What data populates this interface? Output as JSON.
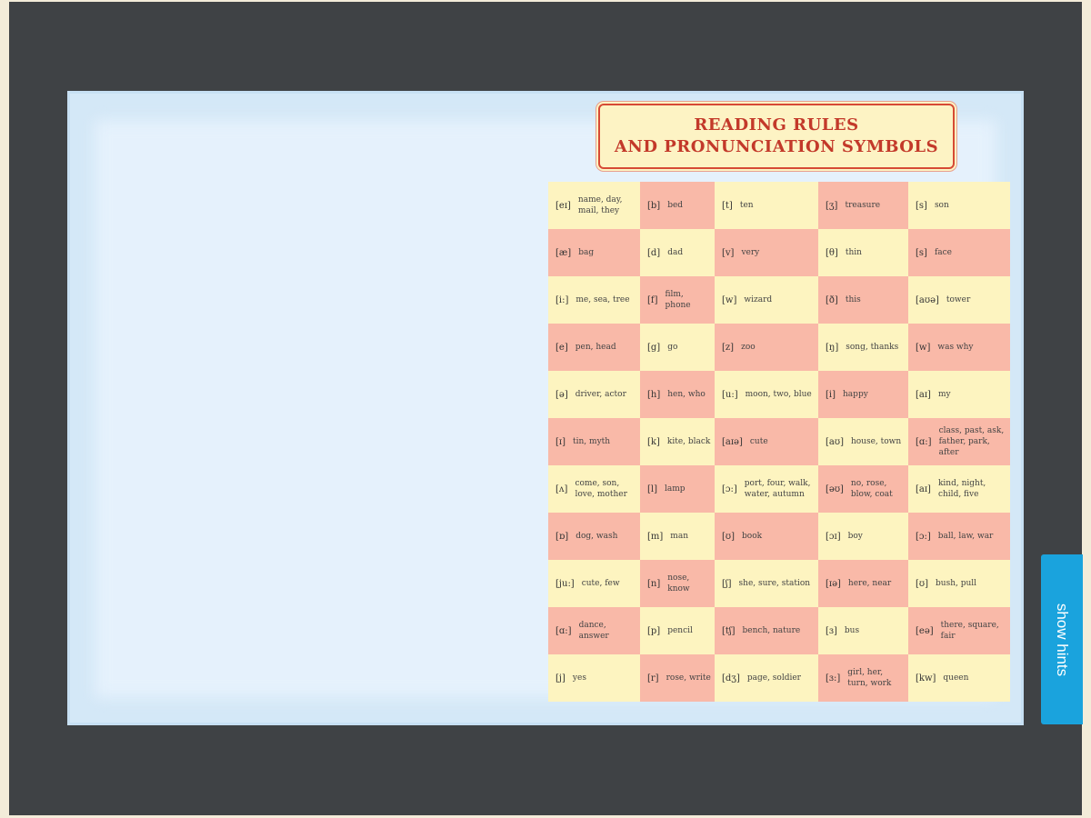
{
  "title": {
    "line1": "READING RULES",
    "line2": "AND PRONUNCIATION SYMBOLS"
  },
  "cell_colors": {
    "yellow": "#fdf4c0",
    "pink": "#f9b9a8"
  },
  "table": [
    [
      {
        "sym": "[eɪ]",
        "ex": "name, day, mail, they",
        "bg": "y"
      },
      {
        "sym": "[b]",
        "ex": "bed",
        "bg": "p"
      },
      {
        "sym": "[t]",
        "ex": "ten",
        "bg": "y"
      },
      {
        "sym": "[ʒ]",
        "ex": "treasure",
        "bg": "p"
      },
      {
        "sym": "[s]",
        "ex": "son",
        "bg": "y"
      }
    ],
    [
      {
        "sym": "[æ]",
        "ex": "bag",
        "bg": "p"
      },
      {
        "sym": "[d]",
        "ex": "dad",
        "bg": "y"
      },
      {
        "sym": "[v]",
        "ex": "very",
        "bg": "p"
      },
      {
        "sym": "[θ]",
        "ex": "thin",
        "bg": "y"
      },
      {
        "sym": "[s]",
        "ex": "face",
        "bg": "p"
      }
    ],
    [
      {
        "sym": "[i:]",
        "ex": "me, sea, tree",
        "bg": "y"
      },
      {
        "sym": "[f]",
        "ex": "film, phone",
        "bg": "p"
      },
      {
        "sym": "[w]",
        "ex": "wizard",
        "bg": "y"
      },
      {
        "sym": "[ð]",
        "ex": "this",
        "bg": "p"
      },
      {
        "sym": "[aʊə]",
        "ex": "tower",
        "bg": "y"
      }
    ],
    [
      {
        "sym": "[e]",
        "ex": "pen, head",
        "bg": "p"
      },
      {
        "sym": "[g]",
        "ex": "go",
        "bg": "y"
      },
      {
        "sym": "[z]",
        "ex": "zoo",
        "bg": "p"
      },
      {
        "sym": "[ŋ]",
        "ex": "song, thanks",
        "bg": "y"
      },
      {
        "sym": "[w]",
        "ex": "was why",
        "bg": "p"
      }
    ],
    [
      {
        "sym": "[ə]",
        "ex": "driver, actor",
        "bg": "y"
      },
      {
        "sym": "[h]",
        "ex": "hen, who",
        "bg": "p"
      },
      {
        "sym": "[u:]",
        "ex": "moon, two, blue",
        "bg": "y"
      },
      {
        "sym": "[i]",
        "ex": "happy",
        "bg": "p"
      },
      {
        "sym": "[aɪ]",
        "ex": "my",
        "bg": "y"
      }
    ],
    [
      {
        "sym": "[ɪ]",
        "ex": "tin, myth",
        "bg": "p"
      },
      {
        "sym": "[k]",
        "ex": "kite, black",
        "bg": "y"
      },
      {
        "sym": "[aɪə]",
        "ex": "cute",
        "bg": "p"
      },
      {
        "sym": "[aʊ]",
        "ex": "house, town",
        "bg": "y"
      },
      {
        "sym": "[ɑ:]",
        "ex": "class, past, ask, father, park, after",
        "bg": "p"
      }
    ],
    [
      {
        "sym": "[ʌ]",
        "ex": "come, son, love, mother",
        "bg": "y"
      },
      {
        "sym": "[l]",
        "ex": "lamp",
        "bg": "p"
      },
      {
        "sym": "[ɔ:]",
        "ex": "port, four, walk, water, autumn",
        "bg": "y"
      },
      {
        "sym": "[əʊ]",
        "ex": "no, rose, blow, coat",
        "bg": "p"
      },
      {
        "sym": "[aɪ]",
        "ex": "kind, night, child, five",
        "bg": "y"
      }
    ],
    [
      {
        "sym": "[ɒ]",
        "ex": "dog, wash",
        "bg": "p"
      },
      {
        "sym": "[m]",
        "ex": "man",
        "bg": "y"
      },
      {
        "sym": "[ʊ]",
        "ex": "book",
        "bg": "p"
      },
      {
        "sym": "[ɔɪ]",
        "ex": "boy",
        "bg": "y"
      },
      {
        "sym": "[ɔ:]",
        "ex": "ball, law, war",
        "bg": "p"
      }
    ],
    [
      {
        "sym": "[ju:]",
        "ex": "cute, few",
        "bg": "y"
      },
      {
        "sym": "[n]",
        "ex": "nose, know",
        "bg": "p"
      },
      {
        "sym": "[ʃ]",
        "ex": "she, sure, station",
        "bg": "y"
      },
      {
        "sym": "[ɪə]",
        "ex": "here, near",
        "bg": "p"
      },
      {
        "sym": "[ʊ]",
        "ex": "bush, pull",
        "bg": "y"
      }
    ],
    [
      {
        "sym": "[ɑ:]",
        "ex": "dance, answer",
        "bg": "p"
      },
      {
        "sym": "[p]",
        "ex": "pencil",
        "bg": "y"
      },
      {
        "sym": "[tʃ]",
        "ex": "bench, nature",
        "bg": "p"
      },
      {
        "sym": "[ɜ]",
        "ex": "bus",
        "bg": "y"
      },
      {
        "sym": "[eə]",
        "ex": "there, square, fair",
        "bg": "p"
      }
    ],
    [
      {
        "sym": "[j]",
        "ex": "yes",
        "bg": "y"
      },
      {
        "sym": "[r]",
        "ex": "rose, write",
        "bg": "p"
      },
      {
        "sym": "[dʒ]",
        "ex": "page, soldier",
        "bg": "y"
      },
      {
        "sym": "[ɜ:]",
        "ex": "girl, her, turn, work",
        "bg": "p"
      },
      {
        "sym": "[kw]",
        "ex": "queen",
        "bg": "y"
      }
    ]
  ],
  "hints_button": {
    "label": "show hints"
  }
}
